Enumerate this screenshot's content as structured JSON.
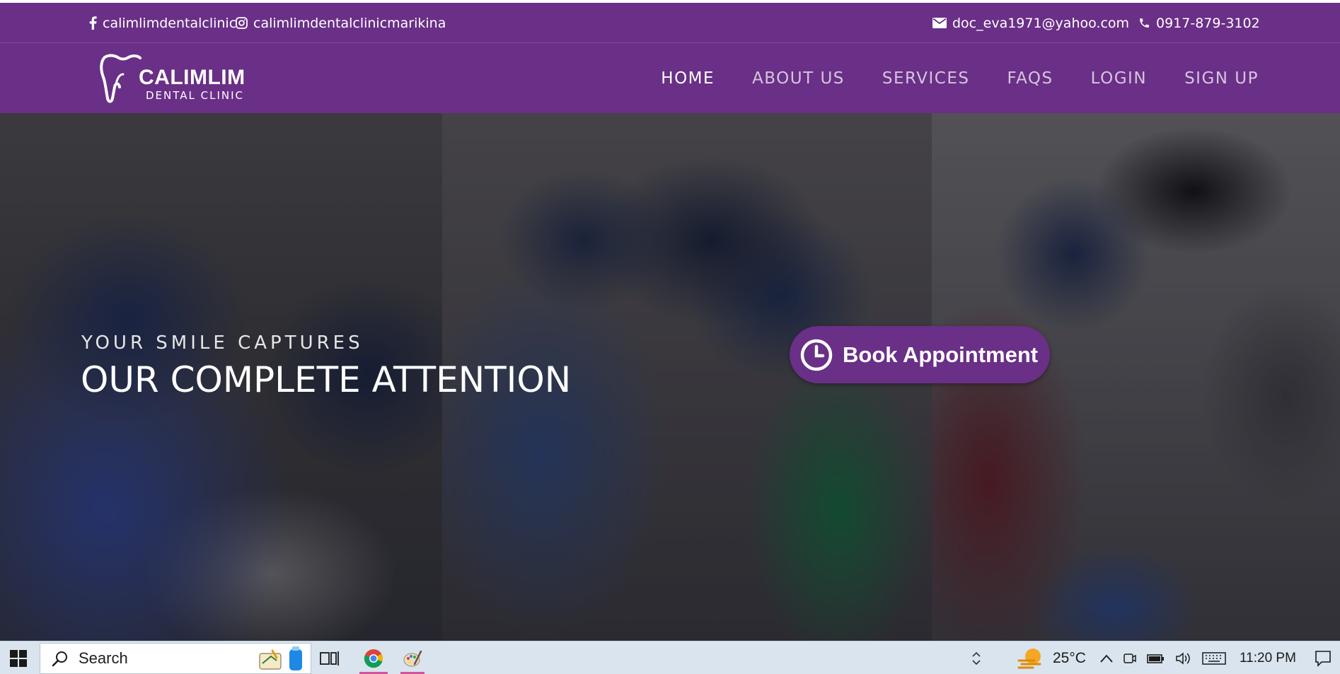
{
  "topbar": {
    "facebook": "calimlimdentalclinic",
    "instagram": "calimlimdentalclinicmarikina",
    "email": "doc_eva1971@yahoo.com",
    "phone": "0917-879-3102"
  },
  "logo": {
    "brand": "CALIMLIM",
    "sub": "DENTAL CLINIC"
  },
  "nav": {
    "items": [
      "HOME",
      "ABOUT US",
      "SERVICES",
      "FAQS",
      "LOGIN",
      "SIGN UP"
    ],
    "active": "HOME"
  },
  "hero": {
    "subtitle": "YOUR SMILE CAPTURES",
    "title": "OUR COMPLETE ATTENTION",
    "cta": "Book Appointment"
  },
  "taskbar": {
    "search_placeholder": "Search",
    "temperature": "25°C",
    "time": "11:20 PM"
  },
  "colors": {
    "brand_purple": "#6a2f87",
    "taskbar": "#d9e4ee"
  },
  "icons": {
    "topbar": [
      "facebook-icon",
      "instagram-icon",
      "mail-icon",
      "phone-icon"
    ],
    "hero": [
      "clock-icon"
    ],
    "taskbar": [
      "windows-start-icon",
      "search-icon",
      "task-view-icon",
      "chrome-icon",
      "paint-icon",
      "weather-icon",
      "chevron-up-icon",
      "battery-icon",
      "volume-icon",
      "keyboard-icon",
      "notification-icon"
    ]
  }
}
